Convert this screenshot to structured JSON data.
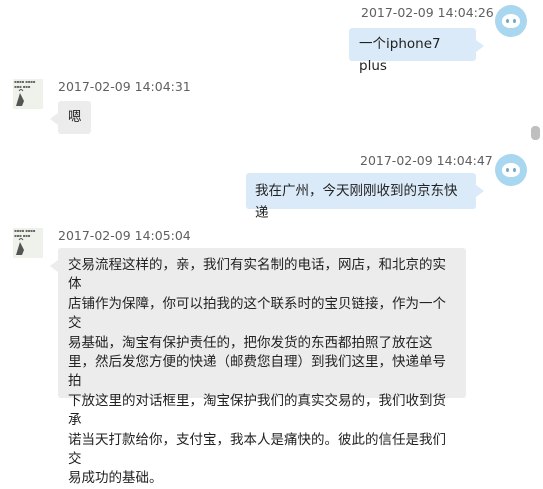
{
  "messages": [
    {
      "side": "right",
      "timestamp": "2017-02-09 14:04:26",
      "text": "一个iphone7 plus"
    },
    {
      "side": "left",
      "timestamp": "2017-02-09 14:04:31",
      "text": "嗯"
    },
    {
      "side": "right",
      "timestamp": "2017-02-09 14:04:47",
      "text": "我在广州，今天刚刚收到的京东快递"
    },
    {
      "side": "left",
      "timestamp": "2017-02-09 14:05:04",
      "lines": [
        "交易流程这样的，亲，我们有实名制的电话，网店，和北京的实体",
        "店铺作为保障，你可以拍我的这个联系时的宝贝链接，作为一个交",
        "易基础，淘宝有保护责任的，把你发货的东西都拍照了放在这",
        "里，然后发您方便的快递（邮费您自理）到我们这里，快递单号拍",
        "下放这里的对话框里，淘宝保护我们的真实交易的，我们收到货承",
        "诺当天打款给你，支付宝，我本人是痛快的。彼此的信任是我们交",
        "易成功的基础。"
      ]
    }
  ],
  "colors": {
    "right_bubble": "#dbeaf8",
    "left_bubble": "#ececec",
    "timestamp": "#5f5f5f",
    "avatar_right": "#a9d7ef"
  },
  "icons": {
    "self_avatar": "cartoon-face-avatar",
    "contact_avatar": "handwriting-avatar"
  }
}
